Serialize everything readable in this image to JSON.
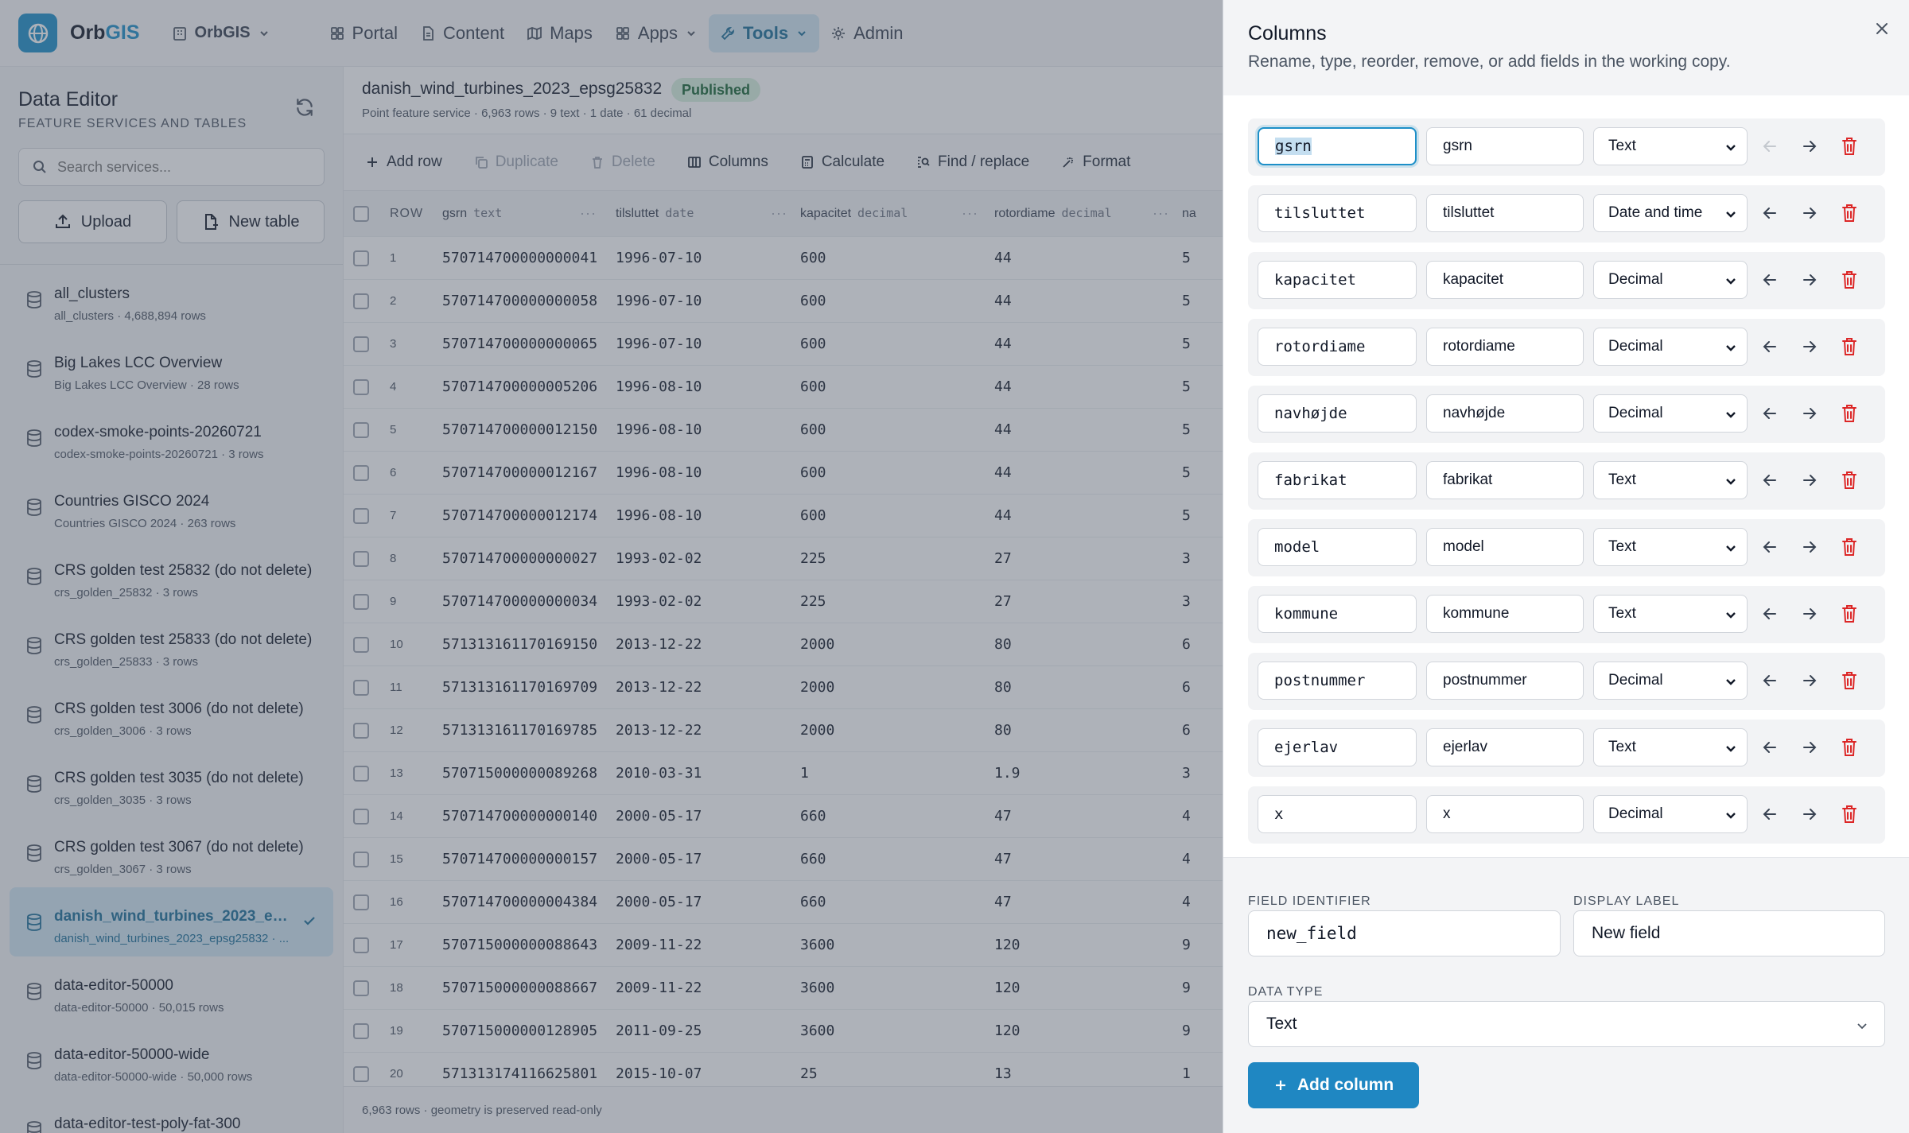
{
  "nav": {
    "brand_main": "Orb",
    "brand_accent": "GIS",
    "org": "OrbGIS",
    "items": [
      {
        "label": "Portal",
        "icon": "grid-icon"
      },
      {
        "label": "Content",
        "icon": "file-icon"
      },
      {
        "label": "Maps",
        "icon": "map-icon"
      },
      {
        "label": "Apps",
        "icon": "apps-icon"
      },
      {
        "label": "Tools",
        "icon": "wrench-icon",
        "active": true
      },
      {
        "label": "Admin",
        "icon": "gear-icon"
      }
    ]
  },
  "sidebar": {
    "title": "Data Editor",
    "subtitle": "FEATURE SERVICES AND TABLES",
    "search_placeholder": "Search services...",
    "upload_label": "Upload",
    "new_table_label": "New table",
    "services": [
      {
        "name": "all_clusters",
        "meta": "all_clusters · 4,688,894 rows"
      },
      {
        "name": "Big Lakes LCC Overview",
        "meta": "Big Lakes LCC Overview · 28 rows"
      },
      {
        "name": "codex-smoke-points-20260721",
        "meta": "codex-smoke-points-20260721 · 3 rows"
      },
      {
        "name": "Countries GISCO 2024",
        "meta": "Countries GISCO 2024 · 263 rows"
      },
      {
        "name": "CRS golden test 25832 (do not delete)",
        "meta": "crs_golden_25832 · 3 rows"
      },
      {
        "name": "CRS golden test 25833 (do not delete)",
        "meta": "crs_golden_25833 · 3 rows"
      },
      {
        "name": "CRS golden test 3006 (do not delete)",
        "meta": "crs_golden_3006 · 3 rows"
      },
      {
        "name": "CRS golden test 3035 (do not delete)",
        "meta": "crs_golden_3035 · 3 rows"
      },
      {
        "name": "CRS golden test 3067 (do not delete)",
        "meta": "crs_golden_3067 · 3 rows"
      },
      {
        "name": "danish_wind_turbines_2023_epsg...",
        "meta": "danish_wind_turbines_2023_epsg25832 · ...",
        "selected": true
      },
      {
        "name": "data-editor-50000",
        "meta": "data-editor-50000 · 50,015 rows"
      },
      {
        "name": "data-editor-50000-wide",
        "meta": "data-editor-50000-wide · 50,000 rows"
      },
      {
        "name": "data-editor-test-poly-fat-300",
        "meta": ""
      }
    ]
  },
  "dataset": {
    "title": "danish_wind_turbines_2023_epsg25832",
    "status": "Published",
    "meta": "Point feature service · 6,963 rows · 9 text · 1 date · 61 decimal"
  },
  "toolbar": {
    "add_row": "Add row",
    "duplicate": "Duplicate",
    "delete": "Delete",
    "columns": "Columns",
    "calculate": "Calculate",
    "find_replace": "Find / replace",
    "format": "Format"
  },
  "grid": {
    "row_header": "ROW",
    "columns": [
      {
        "name": "gsrn",
        "type": "text"
      },
      {
        "name": "tilsluttet",
        "type": "date"
      },
      {
        "name": "kapacitet",
        "type": "decimal"
      },
      {
        "name": "rotordiame",
        "type": "decimal"
      },
      {
        "name": "na",
        "type": ""
      }
    ],
    "rows": [
      [
        "1",
        "570714700000000041",
        "1996-07-10",
        "600",
        "44",
        "5"
      ],
      [
        "2",
        "570714700000000058",
        "1996-07-10",
        "600",
        "44",
        "5"
      ],
      [
        "3",
        "570714700000000065",
        "1996-07-10",
        "600",
        "44",
        "5"
      ],
      [
        "4",
        "570714700000005206",
        "1996-08-10",
        "600",
        "44",
        "5"
      ],
      [
        "5",
        "570714700000012150",
        "1996-08-10",
        "600",
        "44",
        "5"
      ],
      [
        "6",
        "570714700000012167",
        "1996-08-10",
        "600",
        "44",
        "5"
      ],
      [
        "7",
        "570714700000012174",
        "1996-08-10",
        "600",
        "44",
        "5"
      ],
      [
        "8",
        "570714700000000027",
        "1993-02-02",
        "225",
        "27",
        "3"
      ],
      [
        "9",
        "570714700000000034",
        "1993-02-02",
        "225",
        "27",
        "3"
      ],
      [
        "10",
        "571313161170169150",
        "2013-12-22",
        "2000",
        "80",
        "6"
      ],
      [
        "11",
        "571313161170169709",
        "2013-12-22",
        "2000",
        "80",
        "6"
      ],
      [
        "12",
        "571313161170169785",
        "2013-12-22",
        "2000",
        "80",
        "6"
      ],
      [
        "13",
        "570715000000089268",
        "2010-03-31",
        "1",
        "1.9",
        "3"
      ],
      [
        "14",
        "570714700000000140",
        "2000-05-17",
        "660",
        "47",
        "4"
      ],
      [
        "15",
        "570714700000000157",
        "2000-05-17",
        "660",
        "47",
        "4"
      ],
      [
        "16",
        "570714700000004384",
        "2000-05-17",
        "660",
        "47",
        "4"
      ],
      [
        "17",
        "570715000000088643",
        "2009-11-22",
        "3600",
        "120",
        "9"
      ],
      [
        "18",
        "570715000000088667",
        "2009-11-22",
        "3600",
        "120",
        "9"
      ],
      [
        "19",
        "570715000000128905",
        "2011-09-25",
        "3600",
        "120",
        "9"
      ],
      [
        "20",
        "571313174116625801",
        "2015-10-07",
        "25",
        "13",
        "1"
      ]
    ],
    "footer": "6,963 rows · geometry is preserved read-only"
  },
  "panel": {
    "title": "Columns",
    "subtitle": "Rename, type, reorder, remove, or add fields in the working copy.",
    "columns": [
      {
        "id": "gsrn",
        "label": "gsrn",
        "type": "Text",
        "focused": true
      },
      {
        "id": "tilsluttet",
        "label": "tilsluttet",
        "type": "Date and time"
      },
      {
        "id": "kapacitet",
        "label": "kapacitet",
        "type": "Decimal"
      },
      {
        "id": "rotordiame",
        "label": "rotordiame",
        "type": "Decimal"
      },
      {
        "id": "navhøjde",
        "label": "navhøjde",
        "type": "Decimal"
      },
      {
        "id": "fabrikat",
        "label": "fabrikat",
        "type": "Text"
      },
      {
        "id": "model",
        "label": "model",
        "type": "Text"
      },
      {
        "id": "kommune",
        "label": "kommune",
        "type": "Text"
      },
      {
        "id": "postnummer",
        "label": "postnummer",
        "type": "Decimal"
      },
      {
        "id": "ejerlav",
        "label": "ejerlav",
        "type": "Text"
      },
      {
        "id": "x",
        "label": "x",
        "type": "Decimal"
      }
    ],
    "form": {
      "field_identifier_label": "FIELD IDENTIFIER",
      "field_identifier_value": "new_field",
      "display_label_label": "DISPLAY LABEL",
      "display_label_value": "New field",
      "data_type_label": "DATA TYPE",
      "data_type_value": "Text",
      "add_button": "Add column"
    }
  },
  "colors": {
    "accent": "#1d8fc8",
    "published_bg": "#d8f0df",
    "published_text": "#166534",
    "delete_red": "#dc2626",
    "overlay": "rgba(75,85,99,0.45)"
  }
}
